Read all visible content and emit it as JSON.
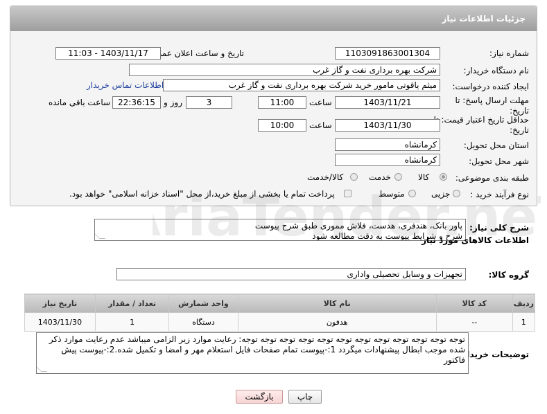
{
  "header": {
    "title": "جزئیات اطلاعات نیاز"
  },
  "fields": {
    "need_number_label": "شماره نیاز:",
    "need_number": "1103091863001304",
    "announce_label": "تاریخ و ساعت اعلان عمومی:",
    "announce_value": "1403/11/17 - 11:03",
    "buyer_org_label": "نام دستگاه خریدار:",
    "buyer_org": "شرکت بهره برداری نفت و گاز غرب",
    "creator_label": "ایجاد کننده درخواست:",
    "creator": "میثم یاقوتی مامور خرید شرکت بهره برداری نفت و گاز غرب",
    "contact_link": "اطلاعات تماس خریدار",
    "deadline_label_1": "مهلت ارسال پاسخ: تا",
    "deadline_label_2": "تاریخ:",
    "deadline_date": "1403/11/21",
    "hour_label": "ساعت",
    "deadline_time": "11:00",
    "days_value": "3",
    "days_label": "روز و",
    "remaining_time": "22:36:15",
    "remaining_label": "ساعت باقی مانده",
    "validity_label_1": "حداقل تاریخ اعتبار قیمت: تا",
    "validity_label_2": "تاریخ:",
    "validity_date": "1403/11/30",
    "validity_hour_label": "ساعت",
    "validity_time": "10:00",
    "province_label": "استان محل تحویل:",
    "province": "کرمانشاه",
    "city_label": "شهر محل تحویل:",
    "city": "کرمانشاه",
    "category_label": "طبقه بندی موضوعی:",
    "category_options": [
      "کالا",
      "خدمت",
      "کالا/خدمت"
    ],
    "process_label": "نوع فرآیند خرید :",
    "process_options": [
      "جزیی",
      "متوسط"
    ],
    "payment_note": "پرداخت تمام یا بخشی از مبلغ خرید،از محل \"اسناد خزانه اسلامی\" خواهد بود."
  },
  "summary": {
    "label": "شرح کلی نیاز:",
    "text_line1": "پاور بانک، هندفری، هدست، فلاش مموری طبق شرح پیوست",
    "text_line2": "شرح و شرایط پیوست به دقت مطالعه شود"
  },
  "goods_section": {
    "title": "اطلاعات کالاهای مورد نیاز",
    "group_label": "گروه کالا:",
    "group_value": "تجهیزات و وسایل تحصیلی واداری"
  },
  "table": {
    "headers": [
      "ردیف",
      "کد کالا",
      "نام کالا",
      "واحد شمارش",
      "تعداد / مقدار",
      "تاریخ نیاز"
    ],
    "rows": [
      [
        "1",
        "--",
        "هدفون",
        "دستگاه",
        "1",
        "1403/11/30"
      ]
    ]
  },
  "buyer_notes": {
    "label": "توضیحات خریدار:",
    "text": "توجه توجه توجه توجه توجه توجه توجه توجه توجه توجه توجه توجه: رعایت موارد زیر الزامی میباشد عدم رعایت موارد ذکر شده موجب ابطال پیشنهادات میگردد 1:-پیوست تمام صفحات  فایل استعلام مهر و امضا و تکمیل شده.2:-پیوست پیش فاکتور"
  },
  "buttons": {
    "print": "چاپ",
    "back": "بازگشت"
  },
  "watermark": "AriaTender.neT"
}
